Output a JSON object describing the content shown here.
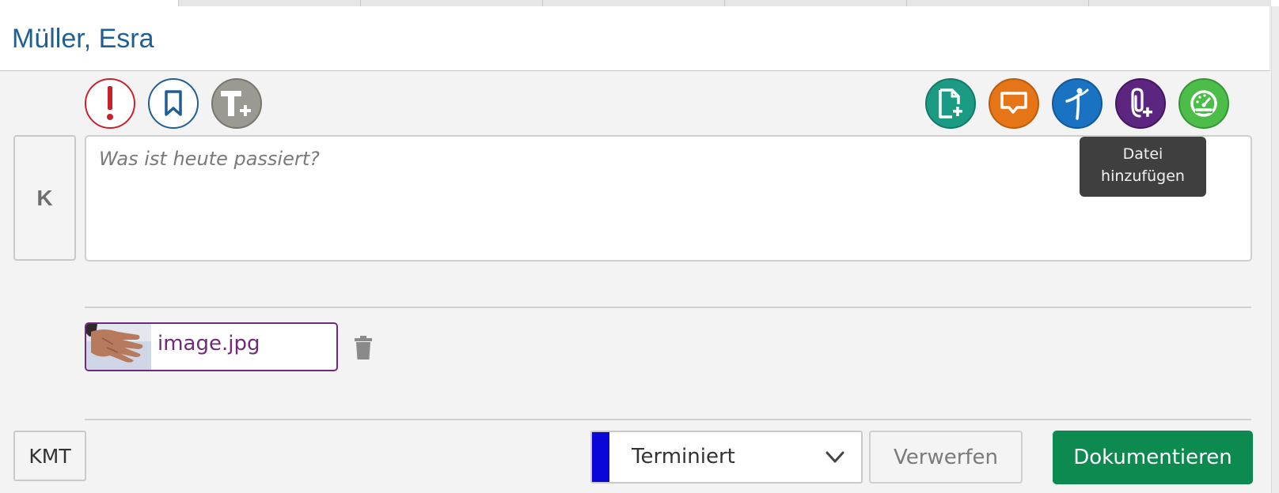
{
  "header": {
    "name": "Müller, Esra"
  },
  "toolbar": {
    "left_icons": [
      {
        "icon": "exclamation-icon",
        "color": "#c8232c"
      },
      {
        "icon": "bookmark-icon",
        "color": "#1f5f94"
      },
      {
        "icon": "text-plus-icon",
        "color": "#9a9a93"
      }
    ],
    "right_icons": [
      {
        "icon": "file-plus-icon",
        "color": "#1c9b84"
      },
      {
        "icon": "message-icon",
        "color": "#e57516"
      },
      {
        "icon": "person-icon",
        "color": "#1a72c2"
      },
      {
        "icon": "paperclip-plus-icon",
        "color": "#5b2580"
      },
      {
        "icon": "gauge-icon",
        "color": "#4cbd48"
      }
    ]
  },
  "entry": {
    "type_label": "K",
    "placeholder": "Was ist heute passiert?"
  },
  "tooltip": {
    "line1": "Datei",
    "line2": "hinzufügen"
  },
  "attachment": {
    "filename": "image.jpg"
  },
  "footer": {
    "kmt_label": "KMT",
    "status": {
      "label": "Terminiert",
      "color": "#0a06d8"
    },
    "discard_label": "Verwerfen",
    "document_label": "Dokumentieren",
    "document_color": "#0d8a4f"
  }
}
